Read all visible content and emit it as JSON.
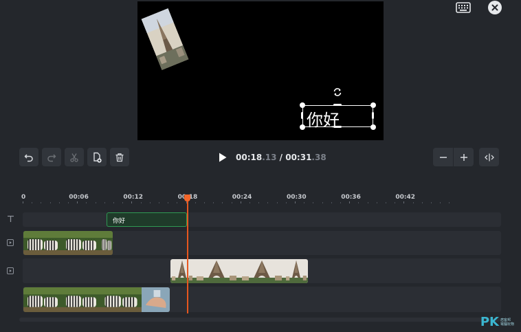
{
  "preview": {
    "overlay_text": "你好"
  },
  "toolbar": {
    "undo_icon": "undo-icon",
    "redo_icon": "redo-icon",
    "cut_icon": "scissors-icon",
    "duplicate_icon": "duplicate-icon",
    "delete_icon": "trash-icon",
    "play_icon": "play-icon",
    "zoom_out_icon": "minus-icon",
    "zoom_in_icon": "plus-icon",
    "fit_icon": "fit-timeline-icon"
  },
  "timecode": {
    "current_main": "00:18",
    "current_frac": ".13",
    "separator": " / ",
    "total_main": "00:31",
    "total_frac": ".38"
  },
  "ruler": {
    "labels": [
      "0",
      "00:06",
      "00:12",
      "00:18",
      "00:24",
      "00:30",
      "00:36",
      "00:42"
    ]
  },
  "tracks": {
    "text_clip_label": "你好"
  },
  "playhead": {
    "time_seconds": 18.13
  },
  "top_right": {
    "keyboard_icon": "keyboard-icon",
    "close_icon": "close-icon"
  },
  "watermark": {
    "brand": "PK",
    "line1": "痞客邦",
    "line2": "電腦玩物"
  },
  "colors": {
    "background": "#24272c",
    "track_bg": "#2b2e34",
    "playhead": "#f2662a",
    "text_clip_border": "#2f9a53"
  }
}
